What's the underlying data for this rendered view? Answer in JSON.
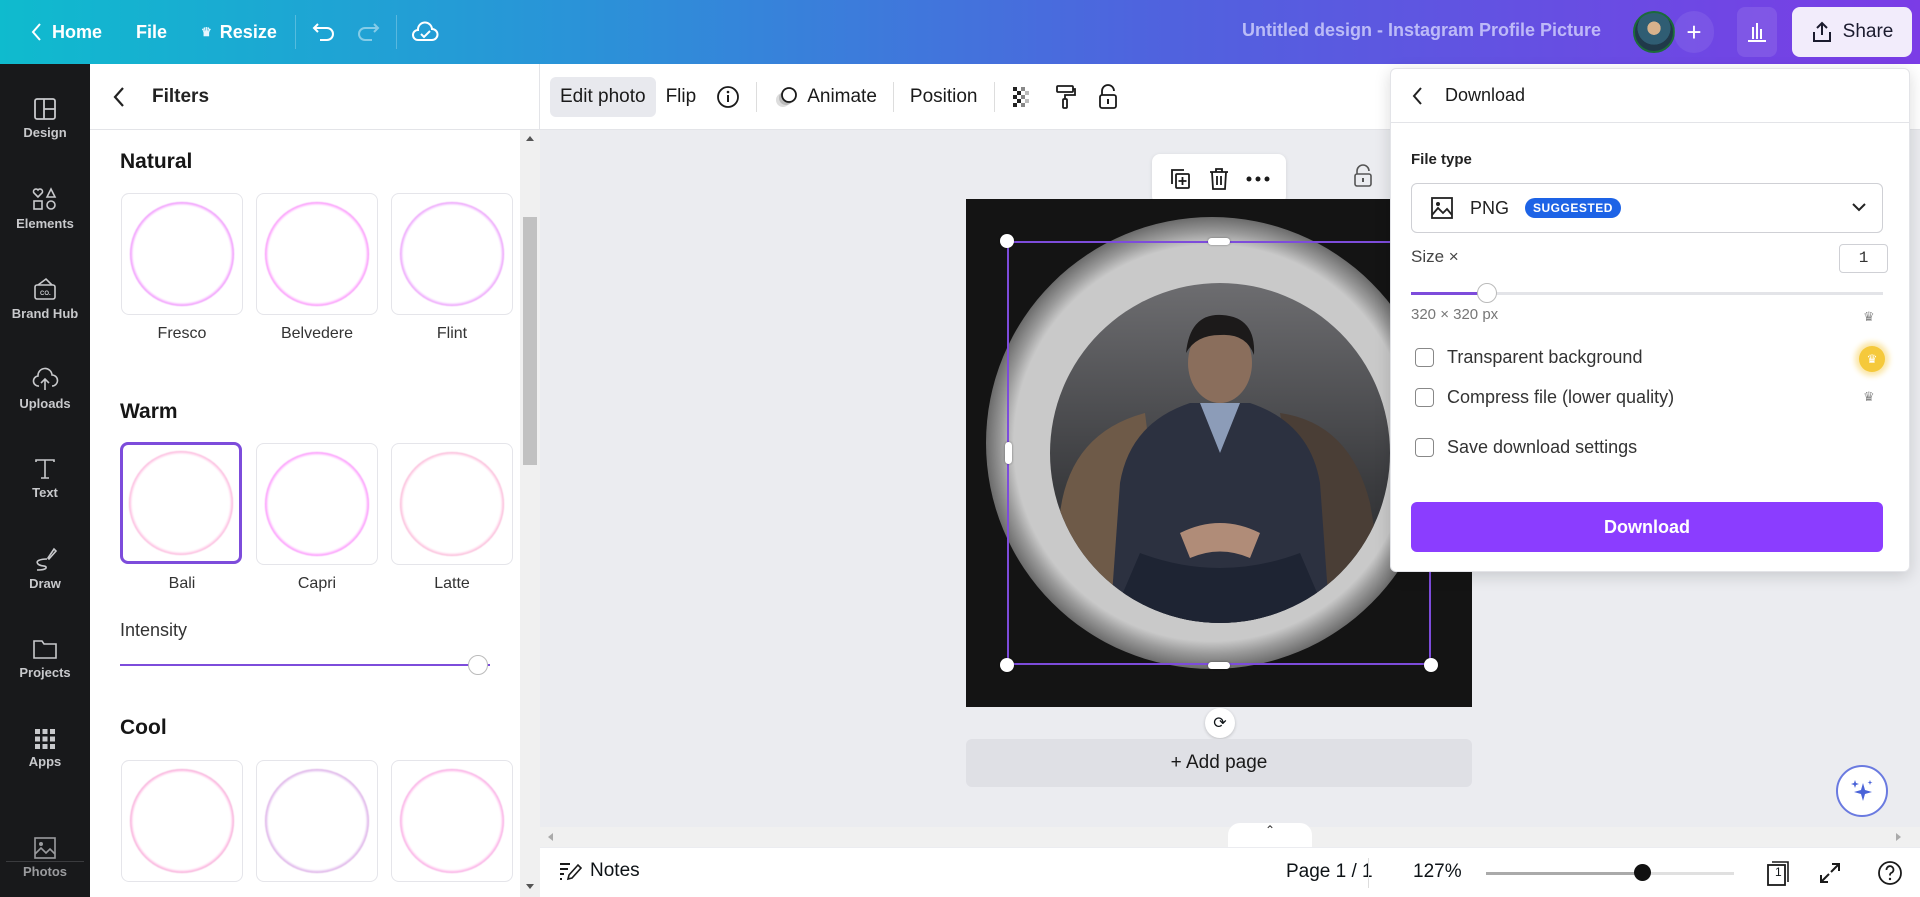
{
  "topbar": {
    "home_label": "Home",
    "file_label": "File",
    "resize_label": "Resize",
    "doc_title": "Untitled design - Instagram Profile Picture",
    "share_label": "Share",
    "add_collaborator_symbol": "+"
  },
  "leftnav": {
    "items": [
      {
        "label": "Design",
        "icon": "layout-icon"
      },
      {
        "label": "Elements",
        "icon": "shapes-icon"
      },
      {
        "label": "Brand Hub",
        "icon": "brand-icon"
      },
      {
        "label": "Uploads",
        "icon": "cloud-upload-icon"
      },
      {
        "label": "Text",
        "icon": "text-icon"
      },
      {
        "label": "Draw",
        "icon": "draw-icon"
      },
      {
        "label": "Projects",
        "icon": "folder-icon"
      },
      {
        "label": "Apps",
        "icon": "grid-icon"
      },
      {
        "label": "Photos",
        "icon": "image-icon"
      }
    ]
  },
  "filters": {
    "title": "Filters",
    "sections": [
      {
        "title": "Natural",
        "items": [
          {
            "label": "Fresco"
          },
          {
            "label": "Belvedere"
          },
          {
            "label": "Flint"
          }
        ]
      },
      {
        "title": "Warm",
        "items": [
          {
            "label": "Bali",
            "selected": true
          },
          {
            "label": "Capri"
          },
          {
            "label": "Latte"
          }
        ]
      },
      {
        "title": "Cool",
        "items": [
          {
            "label": ""
          },
          {
            "label": ""
          },
          {
            "label": ""
          }
        ]
      }
    ],
    "intensity_label": "Intensity",
    "intensity_value_pct": 100
  },
  "context_toolbar": {
    "edit_photo": "Edit photo",
    "flip": "Flip",
    "animate": "Animate",
    "position": "Position"
  },
  "canvas": {
    "add_page_label": "+ Add page"
  },
  "bottombar": {
    "notes_label": "Notes",
    "page_info": "Page 1 / 1",
    "zoom_pct": "127%",
    "zoom_slider_fraction": 0.63,
    "page_count": "1"
  },
  "download": {
    "title": "Download",
    "file_type_label": "File type",
    "file_type": "PNG",
    "suggested_badge": "SUGGESTED",
    "size_label": "Size ×",
    "size_value": "1",
    "size_slider_fraction": 0.16,
    "dimensions": "320 × 320 px",
    "options": [
      {
        "label": "Transparent background",
        "checked": false,
        "pro": "gold"
      },
      {
        "label": "Compress file (lower quality)",
        "checked": false,
        "pro": "gray"
      },
      {
        "label": "Save download settings",
        "checked": false
      }
    ],
    "button_label": "Download",
    "colors": {
      "accent": "#8b3dff",
      "badge": "#1d63e6",
      "selection": "#7d4cdb"
    }
  }
}
